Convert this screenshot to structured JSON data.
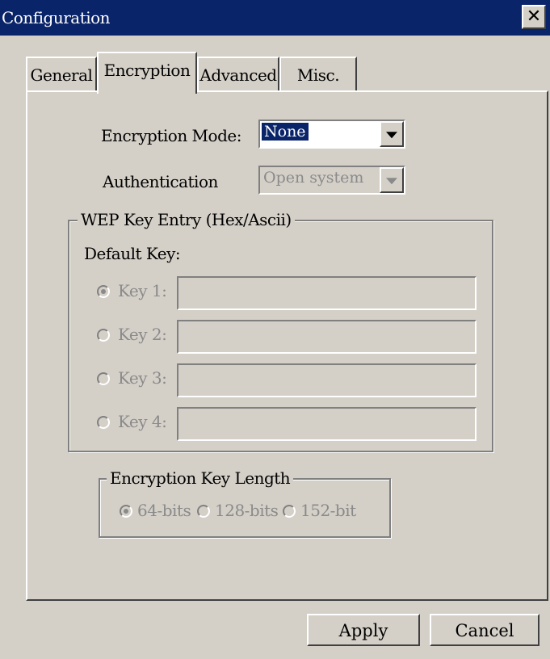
{
  "window": {
    "title": "Configuration"
  },
  "tabs": [
    {
      "label": "General",
      "active": false
    },
    {
      "label": "Encryption",
      "active": true
    },
    {
      "label": "Advanced",
      "active": false
    },
    {
      "label": "Misc.",
      "active": false
    }
  ],
  "encryption_mode": {
    "label": "Encryption Mode:",
    "value": "None"
  },
  "authentication": {
    "label": "Authentication",
    "value": "Open system",
    "enabled": false
  },
  "wep_group": {
    "legend": "WEP Key Entry (Hex/Ascii)",
    "default_key_label": "Default Key:",
    "keys": [
      {
        "label": "Key 1:",
        "selected": true,
        "value": ""
      },
      {
        "label": "Key 2:",
        "selected": false,
        "value": ""
      },
      {
        "label": "Key 3:",
        "selected": false,
        "value": ""
      },
      {
        "label": "Key 4:",
        "selected": false,
        "value": ""
      }
    ]
  },
  "key_length_group": {
    "legend": "Encryption Key Length",
    "options": [
      {
        "label": "64-bits",
        "selected": true
      },
      {
        "label": "128-bits",
        "selected": false
      },
      {
        "label": "152-bit",
        "selected": false
      }
    ]
  },
  "buttons": {
    "apply": "Apply",
    "cancel": "Cancel"
  },
  "colors": {
    "face": "#d4d0c8",
    "titlebar": "#0a246a",
    "selection": "#0a246a",
    "disabled_text": "#8a8a8a"
  },
  "icons": {
    "close": "close-icon",
    "dropdown": "chevron-down-icon"
  }
}
